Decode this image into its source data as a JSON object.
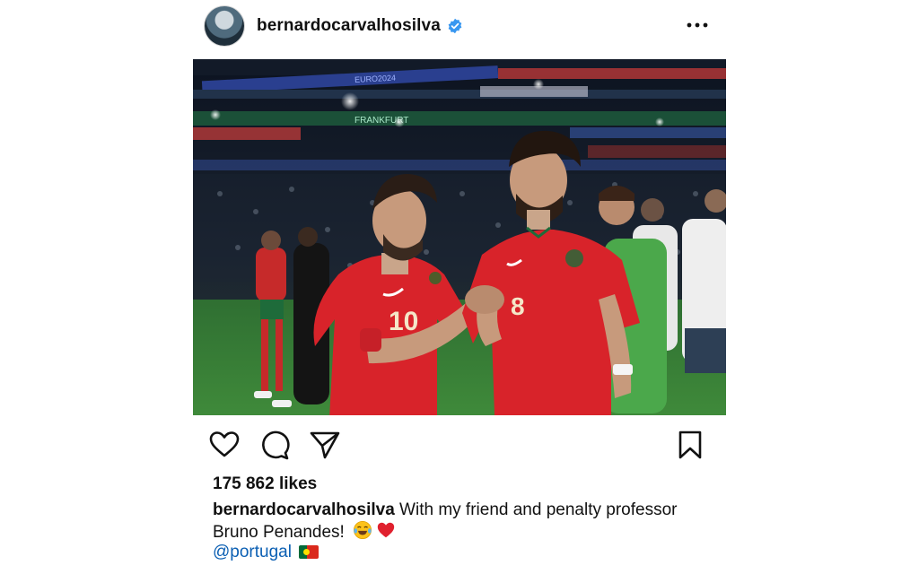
{
  "post": {
    "username": "bernardocarvalhosilva",
    "likes": "175 862 likes",
    "caption_user": "bernardocarvalhosilva",
    "caption_text_1": " With my friend and penalty professor",
    "caption_text_2": "Bruno Penandes!",
    "mention": "@portugal",
    "photo_banner_1": "EURO2024",
    "photo_banner_2": "FRANKFURT",
    "player1_number": "10",
    "player2_number": "8"
  },
  "icons": {
    "verified": "verified-badge-icon",
    "more": "more-options-icon",
    "like": "heart-icon",
    "comment": "comment-icon",
    "share": "send-icon",
    "save": "bookmark-icon",
    "emoji_laugh": "tears-of-joy-emoji",
    "emoji_heart": "red-heart-emoji",
    "flag": "portugal-flag-emoji"
  },
  "colors": {
    "verified": "#3897f0",
    "mention": "#0b5fb3",
    "jersey": "#d8232a",
    "pitch": "#3f8a3a"
  }
}
